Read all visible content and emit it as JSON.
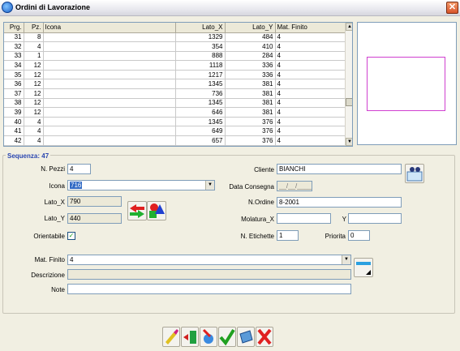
{
  "window": {
    "title": "Ordini di Lavorazione"
  },
  "grid": {
    "headers": [
      "Prg.",
      "Pz.",
      "Icona",
      "Lato_X",
      "Lato_Y",
      "Mat. Finito"
    ],
    "rows": [
      [
        "31",
        "8",
        "",
        "1329",
        "484",
        "4"
      ],
      [
        "32",
        "4",
        "",
        "354",
        "410",
        "4"
      ],
      [
        "33",
        "1",
        "",
        "888",
        "284",
        "4"
      ],
      [
        "34",
        "12",
        "",
        "1118",
        "336",
        "4"
      ],
      [
        "35",
        "12",
        "",
        "1217",
        "336",
        "4"
      ],
      [
        "36",
        "12",
        "",
        "1345",
        "381",
        "4"
      ],
      [
        "37",
        "12",
        "",
        "736",
        "381",
        "4"
      ],
      [
        "38",
        "12",
        "",
        "1345",
        "381",
        "4"
      ],
      [
        "39",
        "12",
        "",
        "646",
        "381",
        "4"
      ],
      [
        "40",
        "4",
        "",
        "1345",
        "376",
        "4"
      ],
      [
        "41",
        "4",
        "",
        "649",
        "376",
        "4"
      ],
      [
        "42",
        "4",
        "",
        "657",
        "376",
        "4"
      ]
    ]
  },
  "sequence": {
    "label": "Sequenza:",
    "value": "47"
  },
  "form": {
    "npezzi_label": "N. Pezzi",
    "npezzi_value": "4",
    "icona_label": "Icona",
    "icona_value": "716",
    "latox_label": "Lato_X",
    "latox_value": "790",
    "latoy_label": "Lato_Y",
    "latoy_value": "440",
    "orientabile_label": "Orientabile",
    "orientabile_checked": "✓",
    "cliente_label": "Cliente",
    "cliente_value": "BIANCHI",
    "data_consegna_label": "Data Consegna",
    "data_consegna_value": "__/__/____",
    "nordine_label": "N.Ordine",
    "nordine_value": "8-2001",
    "molatura_label": "Molatura_X",
    "molatura_value": "",
    "y_label": "Y",
    "y_value": "",
    "netichette_label": "N. Etichette",
    "netichette_value": "1",
    "priorita_label": "Priorita",
    "priorita_value": "0",
    "matfinito_label": "Mat. Finito",
    "matfinito_value": "4",
    "descrizione_label": "Descrizione",
    "descrizione_value": "",
    "note_label": "Note",
    "note_value": ""
  },
  "colors": {
    "accent": "#2a46b0",
    "preview_border": "#d040d0"
  }
}
